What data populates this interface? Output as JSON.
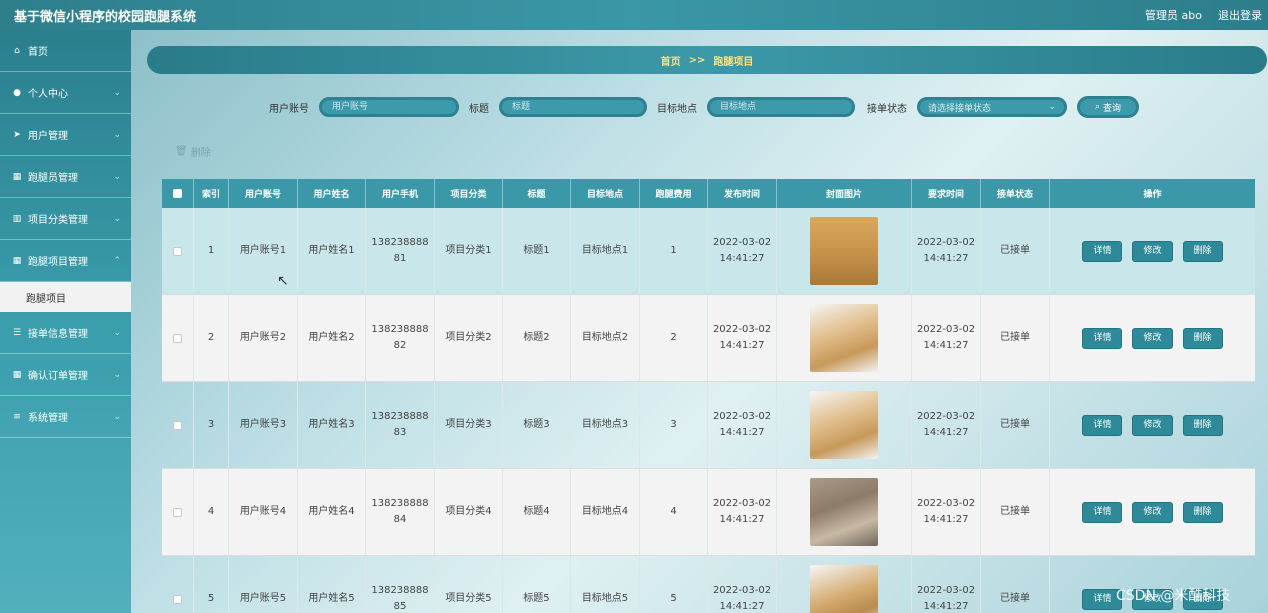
{
  "header": {
    "title": "基于微信小程序的校园跑腿系统",
    "user": "管理员 abo",
    "logout": "退出登录"
  },
  "sidebar": {
    "items": [
      {
        "label": "首页",
        "icon": "home-icon",
        "glyph": "⌂",
        "has_children": false
      },
      {
        "label": "个人中心",
        "icon": "user-icon",
        "glyph": "●",
        "has_children": true
      },
      {
        "label": "用户管理",
        "icon": "send-icon",
        "glyph": "➤",
        "has_children": true
      },
      {
        "label": "跑腿员管理",
        "icon": "grid-icon",
        "glyph": "▦",
        "has_children": true
      },
      {
        "label": "项目分类管理",
        "icon": "bar-chart-icon",
        "glyph": "▥",
        "has_children": true
      },
      {
        "label": "跑腿项目管理",
        "icon": "grid-icon",
        "glyph": "▦",
        "has_children": true
      },
      {
        "label": "接单信息管理",
        "icon": "sliders-icon",
        "glyph": "☰",
        "has_children": true
      },
      {
        "label": "确认订单管理",
        "icon": "grid-icon",
        "glyph": "▦",
        "has_children": true
      },
      {
        "label": "系统管理",
        "icon": "list-icon",
        "glyph": "≡",
        "has_children": true
      }
    ],
    "active_sub": "跑腿项目"
  },
  "breadcrumb": {
    "home": "首页",
    "sep": ">>",
    "current": "跑腿项目"
  },
  "search": {
    "account_label": "用户账号",
    "account_placeholder": "用户账号",
    "title_label": "标题",
    "title_placeholder": "标题",
    "target_label": "目标地点",
    "target_placeholder": "目标地点",
    "status_label": "接单状态",
    "status_placeholder": "请选择接单状态",
    "query_button": "查询"
  },
  "toolbar": {
    "delete_label": "删除"
  },
  "table": {
    "columns": [
      "索引",
      "用户账号",
      "用户姓名",
      "用户手机",
      "项目分类",
      "标题",
      "目标地点",
      "跑腿费用",
      "发布时间",
      "封面图片",
      "要求时间",
      "接单状态",
      "操作"
    ],
    "actions": {
      "detail": "详情",
      "edit": "修改",
      "delete": "删除"
    },
    "rows": [
      {
        "index": "1",
        "account": "用户账号1",
        "name": "用户姓名1",
        "phone_a": "138238888",
        "phone_b": "81",
        "category": "项目分类1",
        "title": "标题1",
        "target": "目标地点1",
        "fee": "1",
        "pub_date": "2022-03-02",
        "pub_time": "14:41:27",
        "req_date": "2022-03-02",
        "req_time": "14:41:27",
        "status": "已接单",
        "image": "box-closed"
      },
      {
        "index": "2",
        "account": "用户账号2",
        "name": "用户姓名2",
        "phone_a": "138238888",
        "phone_b": "82",
        "category": "项目分类2",
        "title": "标题2",
        "target": "目标地点2",
        "fee": "2",
        "pub_date": "2022-03-02",
        "pub_time": "14:41:27",
        "req_date": "2022-03-02",
        "req_time": "14:41:27",
        "status": "已接单",
        "image": "box-open"
      },
      {
        "index": "3",
        "account": "用户账号3",
        "name": "用户姓名3",
        "phone_a": "138238888",
        "phone_b": "83",
        "category": "项目分类3",
        "title": "标题3",
        "target": "目标地点3",
        "fee": "3",
        "pub_date": "2022-03-02",
        "pub_time": "14:41:27",
        "req_date": "2022-03-02",
        "req_time": "14:41:27",
        "status": "已接单",
        "image": "box-open"
      },
      {
        "index": "4",
        "account": "用户账号4",
        "name": "用户姓名4",
        "phone_a": "138238888",
        "phone_b": "84",
        "category": "项目分类4",
        "title": "标题4",
        "target": "目标地点4",
        "fee": "4",
        "pub_date": "2022-03-02",
        "pub_time": "14:41:27",
        "req_date": "2022-03-02",
        "req_time": "14:41:27",
        "status": "已接单",
        "image": "box-pack"
      },
      {
        "index": "5",
        "account": "用户账号5",
        "name": "用户姓名5",
        "phone_a": "138238888",
        "phone_b": "85",
        "category": "项目分类5",
        "title": "标题5",
        "target": "目标地点5",
        "fee": "5",
        "pub_date": "2022-03-02",
        "pub_time": "14:41:27",
        "req_date": "2022-03-02",
        "req_time": "14:41:27",
        "status": "已接单",
        "image": "box-stack"
      }
    ]
  },
  "watermark": "CSDN @米酷科技",
  "colors": {
    "primary": "#3a98a8",
    "primary_dark": "#2a7b89",
    "breadcrumb_text": "#ffe17a"
  }
}
